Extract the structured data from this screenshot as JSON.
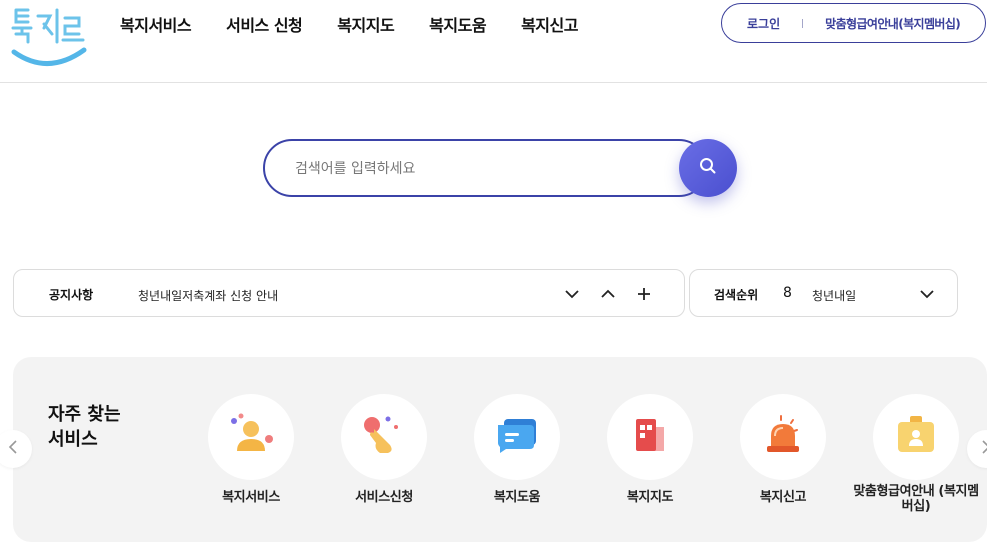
{
  "header": {
    "logo_text": "복지로",
    "nav": [
      "복지서비스",
      "서비스 신청",
      "복지지도",
      "복지도움",
      "복지신고"
    ],
    "login": "로그인",
    "member_guide": "맞춤형급여안내(복지멤버십)"
  },
  "search": {
    "placeholder": "검색어를 입력하세요"
  },
  "notice": {
    "label": "공지사항",
    "text": "청년내일저축계좌 신청 안내"
  },
  "rank": {
    "label": "검색순위",
    "number": "8",
    "text": "청년내일"
  },
  "services": {
    "title": "자주 찾는 서비스",
    "items": [
      {
        "label": "복지서비스",
        "icon": "person-icon"
      },
      {
        "label": "서비스신청",
        "icon": "hand-click-icon"
      },
      {
        "label": "복지도움",
        "icon": "chat-bubble-icon"
      },
      {
        "label": "복지지도",
        "icon": "building-icon"
      },
      {
        "label": "복지신고",
        "icon": "siren-icon"
      },
      {
        "label": "맞춤형급여안내 (복지멤버십)",
        "icon": "id-badge-icon"
      }
    ]
  },
  "colors": {
    "accent": "#3b43a8",
    "search_button": "#5a5fdc",
    "panel_bg": "#f3f3f3"
  }
}
